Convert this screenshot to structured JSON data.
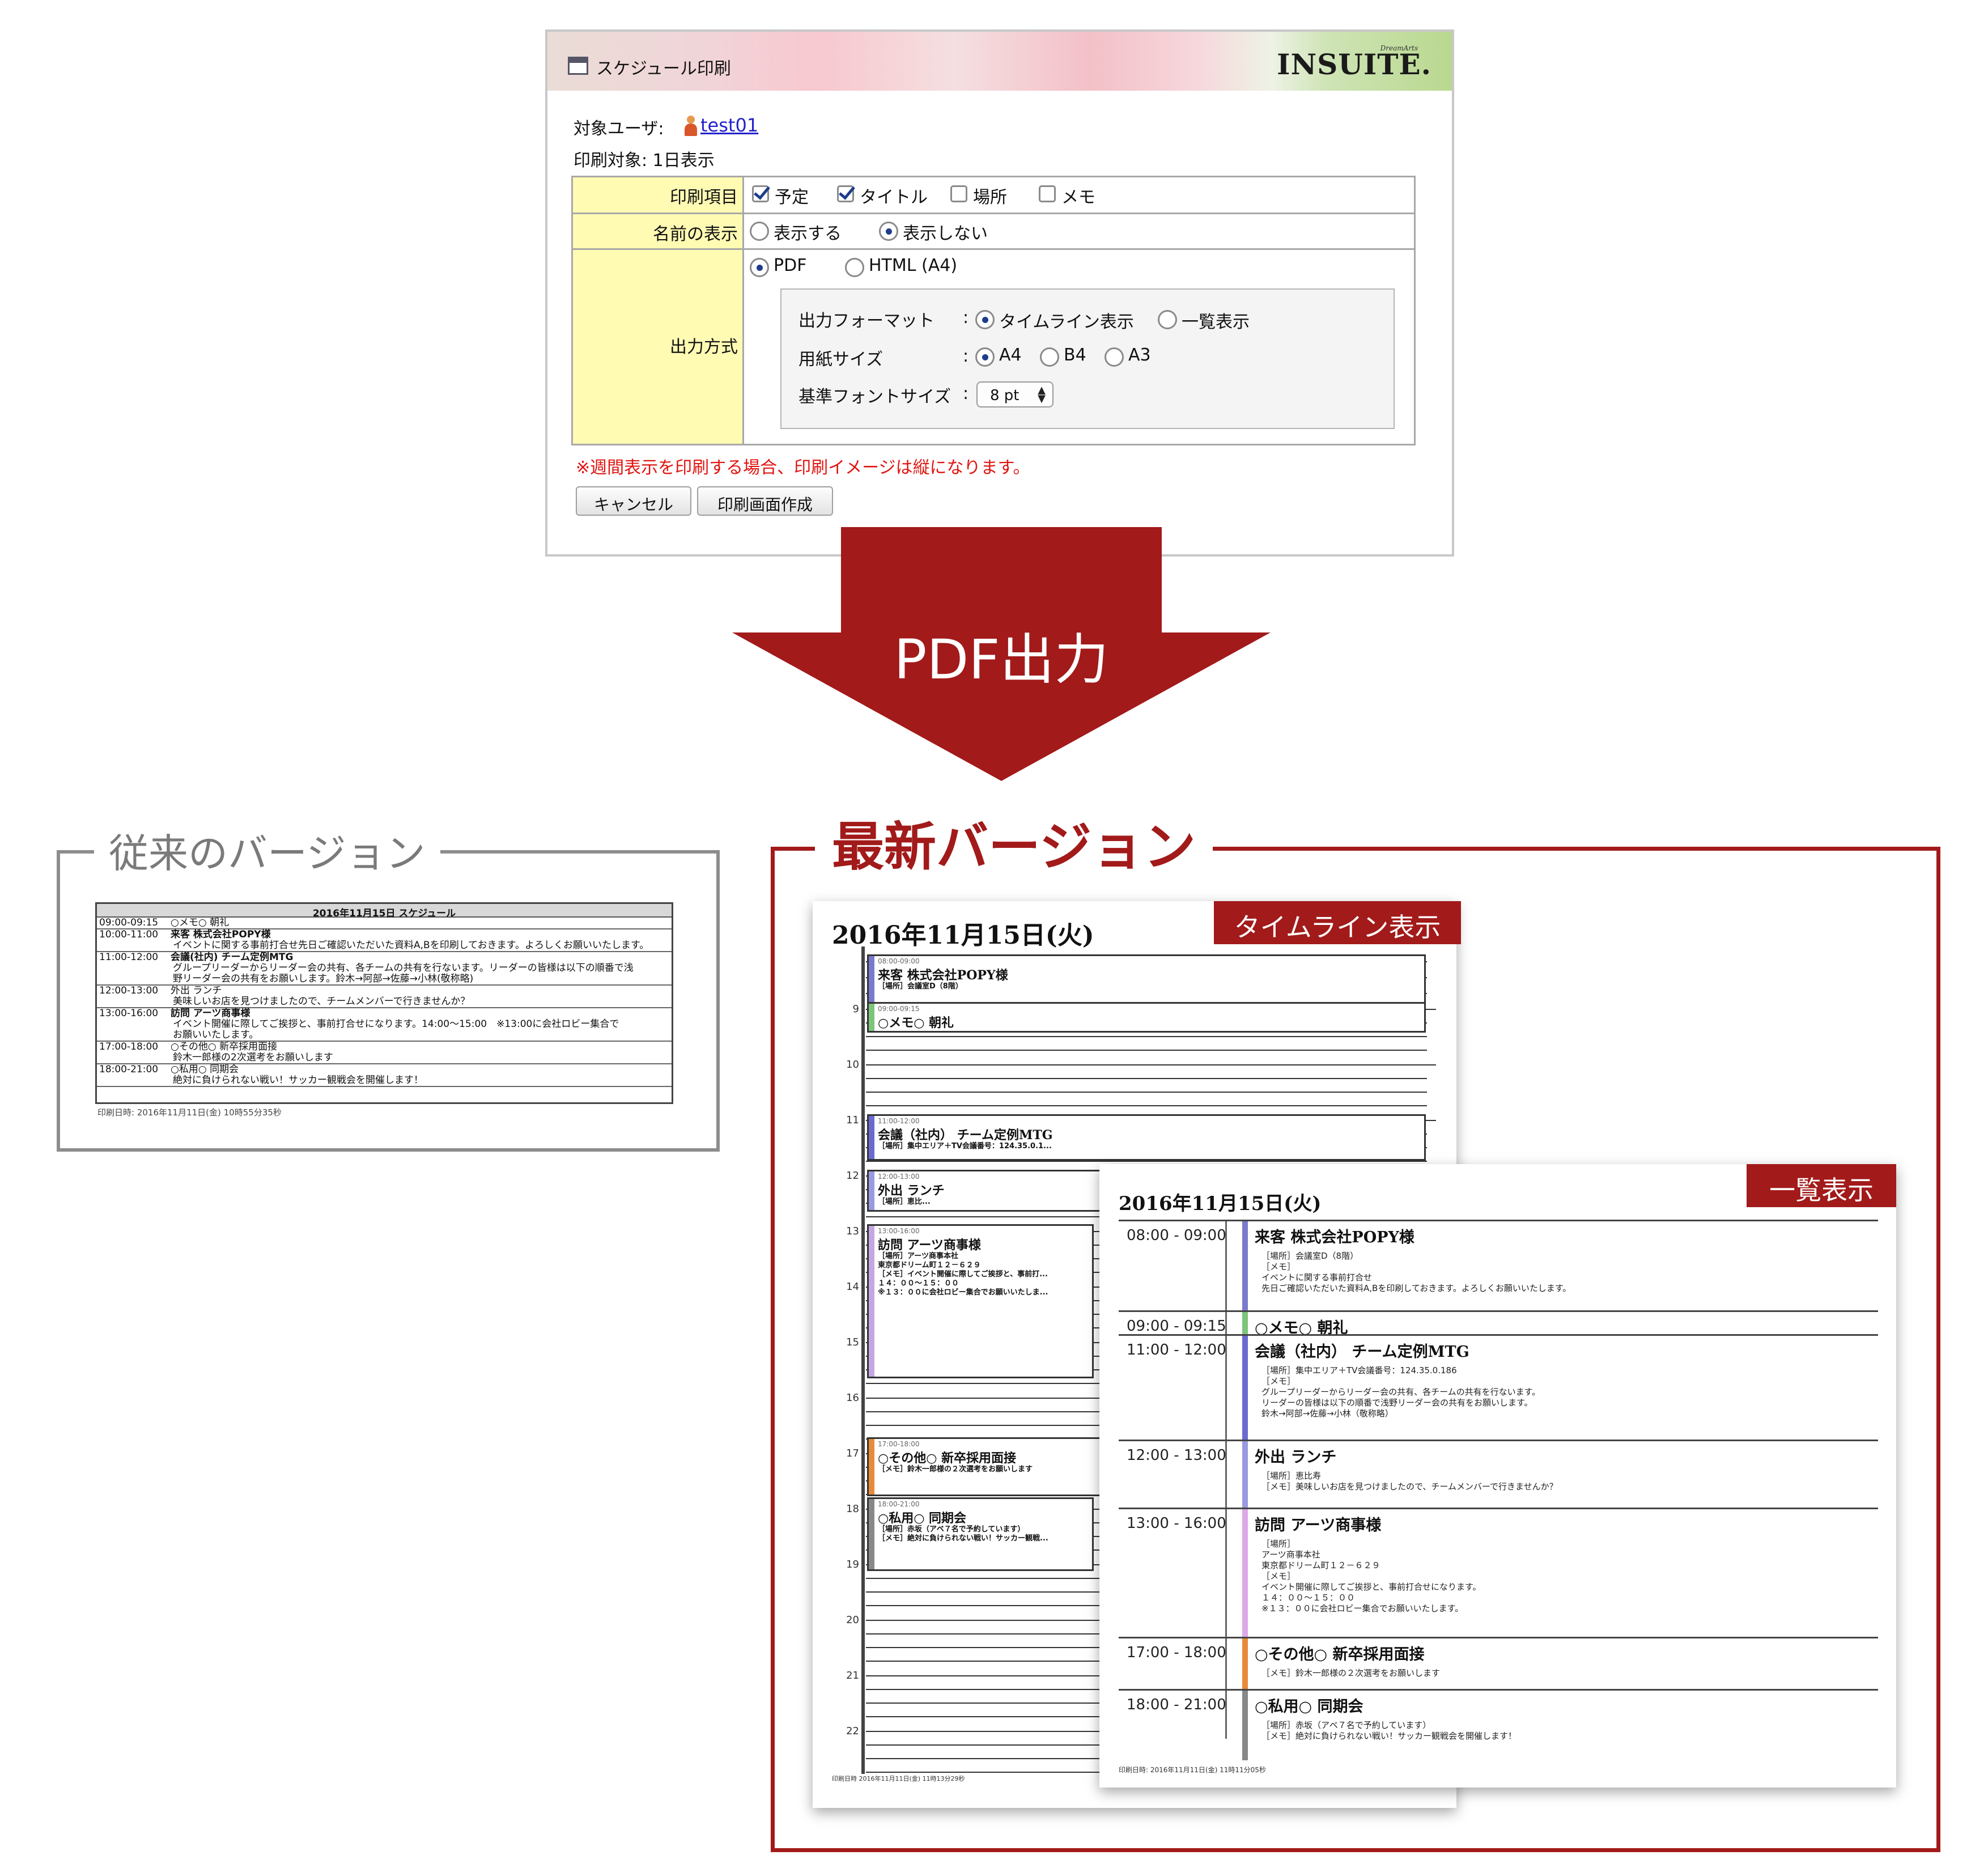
{
  "dialog": {
    "title": "スケジュール印刷",
    "logo_small": "DreamArts",
    "logo": "INSUITE.",
    "target_user_label": "対象ユーザ:",
    "target_user": "test01",
    "print_target": "印刷対象: 1日表示",
    "rows": {
      "print_items": {
        "label": "印刷項目",
        "options": [
          {
            "label": "予定",
            "checked": true
          },
          {
            "label": "タイトル",
            "checked": true
          },
          {
            "label": "場所",
            "checked": false
          },
          {
            "label": "メモ",
            "checked": false
          }
        ]
      },
      "name_display": {
        "label": "名前の表示",
        "options": [
          {
            "label": "表示する",
            "selected": false
          },
          {
            "label": "表示しない",
            "selected": true
          }
        ]
      },
      "output": {
        "label": "出力方式",
        "options": [
          {
            "label": "PDF",
            "selected": true
          },
          {
            "label": "HTML (A4)",
            "selected": false
          }
        ],
        "format_label": "出力フォーマット",
        "format_options": [
          {
            "label": "タイムライン表示",
            "selected": true
          },
          {
            "label": "一覧表示",
            "selected": false
          }
        ],
        "paper_label": "用紙サイズ",
        "paper_options": [
          {
            "label": "A4",
            "selected": true
          },
          {
            "label": "B4",
            "selected": false
          },
          {
            "label": "A3",
            "selected": false
          }
        ],
        "font_label": "基準フォントサイズ",
        "font_value": "8 pt",
        "colon": ":"
      }
    },
    "warning": "※週間表示を印刷する場合、印刷イメージは縦になります。",
    "buttons": {
      "cancel": "キャンセル",
      "create": "印刷画面作成"
    }
  },
  "arrow_label": "PDF出力",
  "old_version": {
    "title": "従来のバージョン",
    "doc_title": "2016年11月15日 スケジュール",
    "rows": [
      {
        "time": "09:00-09:15",
        "lines": [
          "○メモ○ 朝礼"
        ]
      },
      {
        "time": "10:00-11:00",
        "lines": [
          "来客 株式会社POPY様",
          "イベントに関する事前打合せ先日ご確認いただいた資料A,Bを印刷しておきます。よろしくお願いいたします。"
        ]
      },
      {
        "time": "11:00-12:00",
        "lines": [
          "会議(社内) チーム定例MTG",
          "グループリーダーからリーダー会の共有、各チームの共有を行ないます。リーダーの皆様は以下の順番で浅",
          "野リーダー会の共有をお願いします。鈴木→阿部→佐藤→小林(敬称略)"
        ]
      },
      {
        "time": "12:00-13:00",
        "lines": [
          "外出 ランチ",
          "美味しいお店を見つけましたので、チームメンバーで行きませんか？"
        ]
      },
      {
        "time": "13:00-16:00",
        "lines": [
          "訪問 アーツ商事様",
          "イベント開催に際してご挨拶と、事前打合せになります。14:00〜15:00　※13:00に会社ロビー集合で",
          "お願いいたします。"
        ]
      },
      {
        "time": "17:00-18:00",
        "lines": [
          "○その他○ 新卒採用面接",
          "鈴木一郎様の2次選考をお願いします"
        ]
      },
      {
        "time": "18:00-21:00",
        "lines": [
          "○私用○ 同期会",
          "絶対に負けられない戦い！サッカー観戦会を開催します！"
        ]
      }
    ],
    "footer": "印刷日時: 2016年11月11日(金) 10時55分35秒"
  },
  "new_version": {
    "title": "最新バージョン",
    "timeline": {
      "tag": "タイムライン表示",
      "date": "2016年11月15日(火)",
      "hours": [
        "9",
        "10",
        "11",
        "12",
        "13",
        "14",
        "15",
        "16",
        "17",
        "18",
        "19",
        "20",
        "21",
        "22"
      ],
      "events": [
        {
          "time": "08:00-09:00",
          "name": "来客 株式会社POPY様",
          "detail": "［場所］会議室D（8階）",
          "color": "#7a7acc"
        },
        {
          "time": "09:00-09:15",
          "name": "○メモ○ 朝礼",
          "detail": "",
          "color": "#7cc47c"
        },
        {
          "time": "11:00-12:00",
          "name": "会議（社内） チーム定例MTG",
          "detail": "［場所］集中エリア＋TV会議番号：124.35.0.1...",
          "color": "#6a6ad0"
        },
        {
          "time": "12:00-13:00",
          "name": "外出 ランチ",
          "detail": "［場所］恵比...",
          "color": "#9a9ae0"
        },
        {
          "time": "13:00-16:00",
          "name": "訪問 アーツ商事様",
          "detail": "［場所］アーツ商事本社\n東京都ドリーム町１２－６２９\n［メモ］イベント開催に際してご挨拶と、事前打...\n１４：００〜１５：００\n※１３：００に会社ロビー集合でお願いいたしま...",
          "color": "#c6a6e0"
        },
        {
          "time": "17:00-18:00",
          "name": "○その他○ 新卒採用面接",
          "detail": "［メモ］鈴木一郎様の２次選考をお願いします",
          "color": "#e88a3a"
        },
        {
          "time": "18:00-21:00",
          "name": "○私用○ 同期会",
          "detail": "［場所］赤坂（アベ７名で予約しています）\n［メモ］絶対に負けられない戦い！サッカー観戦...",
          "color": "#888888"
        }
      ],
      "footer": "印刷日時 2016年11月11日(金) 11時13分29秒"
    },
    "list": {
      "tag": "一覧表示",
      "date": "2016年11月15日(火)",
      "rows": [
        {
          "time": "08:00 - 09:00",
          "name": "来客 株式会社POPY様",
          "detail": "［場所］会議室D（8階）\n［メモ］\nイベントに関する事前打合せ\n先日ご確認いただいた資料A,Bを印刷しておきます。よろしくお願いいたします。",
          "color": "#7a7acc"
        },
        {
          "time": "09:00 - 09:15",
          "name": "○メモ○ 朝礼",
          "detail": "",
          "color": "#7cc47c"
        },
        {
          "time": "11:00 - 12:00",
          "name": "会議（社内） チーム定例MTG",
          "detail": "［場所］集中エリア＋TV会議番号：124.35.0.186\n［メモ］\nグループリーダーからリーダー会の共有、各チームの共有を行ないます。\nリーダーの皆様は以下の順番で浅野リーダー会の共有をお願いします。\n鈴木→阿部→佐藤→小林（敬称略）",
          "color": "#6a6ad0"
        },
        {
          "time": "12:00 - 13:00",
          "name": "外出 ランチ",
          "detail": "［場所］恵比寿\n［メモ］美味しいお店を見つけましたので、チームメンバーで行きませんか？",
          "color": "#9a9ae0"
        },
        {
          "time": "13:00 - 16:00",
          "name": "訪問 アーツ商事様",
          "detail": "［場所］\nアーツ商事本社\n東京都ドリーム町１２－６２９\n［メモ］\nイベント開催に際してご挨拶と、事前打合せになります。\n１４：００〜１５：００\n※１３：００に会社ロビー集合でお願いいたします。",
          "color": "#dca8e8"
        },
        {
          "time": "17:00 - 18:00",
          "name": "○その他○ 新卒採用面接",
          "detail": "［メモ］鈴木一郎様の２次選考をお願いします",
          "color": "#e88a3a"
        },
        {
          "time": "18:00 - 21:00",
          "name": "○私用○ 同期会",
          "detail": "［場所］赤坂（アベ７名で予約しています）\n［メモ］絶対に負けられない戦い！サッカー観戦会を開催します！",
          "color": "#888888"
        }
      ],
      "footer": "印刷日時: 2016年11月11日(金) 11時11分05秒"
    }
  },
  "colors": {
    "accent": "#a21a1a",
    "warning": "#e0140f",
    "link": "#2222cc",
    "header_cell": "#fffbb3",
    "check": "#1d3d8c"
  }
}
